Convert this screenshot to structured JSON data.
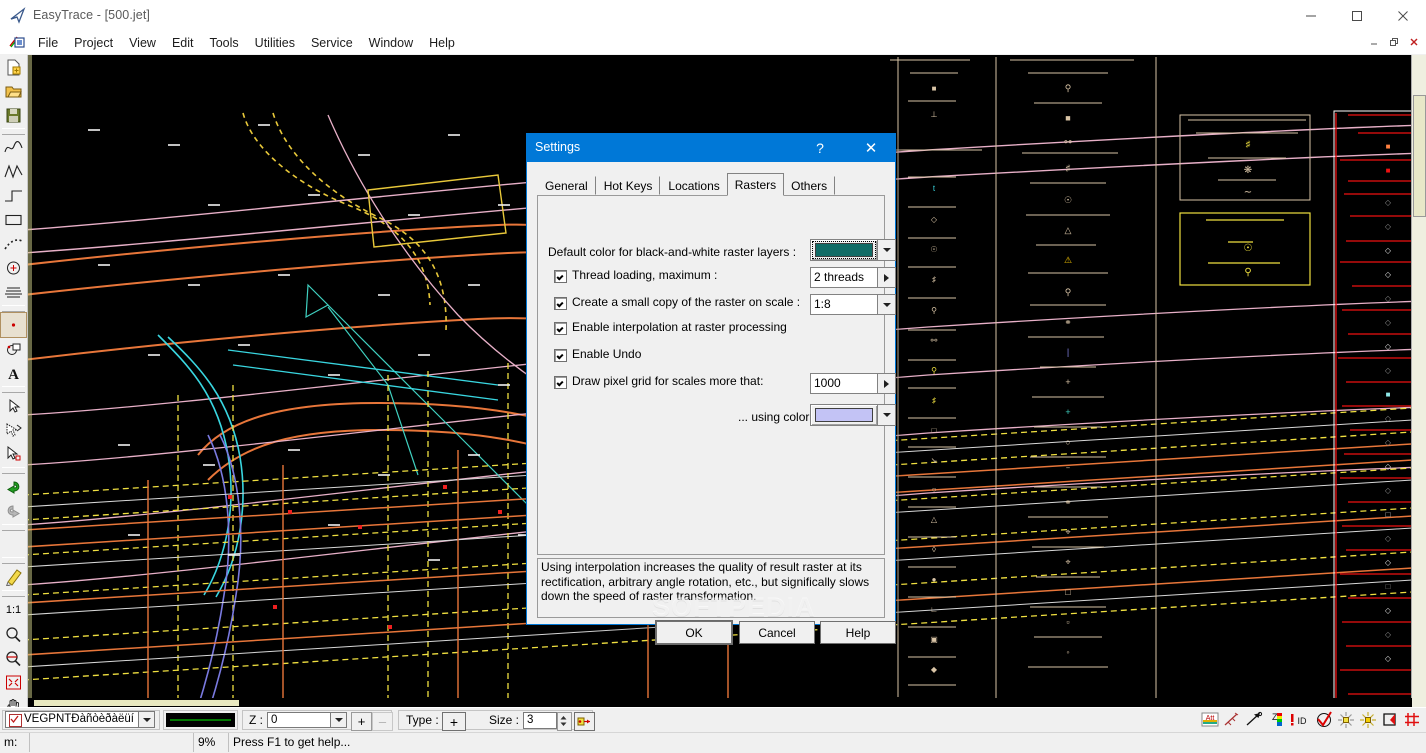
{
  "window": {
    "title": "EasyTrace - [500.jet]",
    "icon": "easytrace-logo-icon",
    "minimize": "–",
    "maximize": "□",
    "close": "✕"
  },
  "mdi": {
    "minimize": "–",
    "restore": "❐",
    "close": "✕"
  },
  "menu": {
    "items": [
      "File",
      "Project",
      "View",
      "Edit",
      "Tools",
      "Utilities",
      "Service",
      "Window",
      "Help"
    ]
  },
  "left_toolbar": {
    "groups": [
      {
        "items": [
          {
            "name": "new-document-icon",
            "glyph": "new"
          },
          {
            "name": "open-folder-icon",
            "glyph": "open"
          },
          {
            "name": "save-disk-icon",
            "glyph": "save"
          }
        ]
      },
      {
        "items": [
          {
            "name": "smooth-polyline-icon",
            "glyph": "curve"
          },
          {
            "name": "polyline-icon",
            "glyph": "zigzag"
          },
          {
            "name": "orthogonal-line-icon",
            "glyph": "step"
          },
          {
            "name": "rectangle-icon",
            "glyph": "rect"
          },
          {
            "name": "dashed-arc-icon",
            "glyph": "dots"
          },
          {
            "name": "circle-point-icon",
            "glyph": "circledot"
          },
          {
            "name": "hatch-fill-icon",
            "glyph": "hatch"
          }
        ]
      },
      {
        "items": [
          {
            "name": "point-object-icon",
            "glyph": "point",
            "selected": true
          },
          {
            "name": "symbol-object-icon",
            "glyph": "symbol"
          },
          {
            "name": "text-tool-icon",
            "glyph": "A"
          }
        ]
      },
      {
        "items": [
          {
            "name": "select-arrow-icon",
            "glyph": "arrow"
          },
          {
            "name": "select-lasso-icon",
            "glyph": "lasso"
          },
          {
            "name": "select-node-icon",
            "glyph": "arrownode"
          }
        ]
      },
      {
        "items": [
          {
            "name": "undo-icon",
            "glyph": "undo"
          },
          {
            "name": "redo-icon",
            "glyph": "redo"
          }
        ]
      },
      {
        "items": [
          {
            "name": "edit-pencil-icon",
            "glyph": "pencil"
          }
        ]
      },
      {
        "items": [
          {
            "name": "zoom-actual-size-button",
            "glyph": "1:1",
            "label": "1:1"
          },
          {
            "name": "zoom-in-icon",
            "glyph": "magnify"
          },
          {
            "name": "zoom-window-icon",
            "glyph": "magnifyred"
          },
          {
            "name": "zoom-extents-icon",
            "glyph": "extents"
          },
          {
            "name": "pan-hand-icon",
            "glyph": "hand"
          },
          {
            "name": "measure-ruler-icon",
            "glyph": "ruler"
          }
        ]
      }
    ]
  },
  "dialog": {
    "title": "Settings",
    "help_glyph": "?",
    "close_glyph": "✕",
    "tabs": [
      {
        "label": "General",
        "active": false
      },
      {
        "label": "Hot Keys",
        "active": false
      },
      {
        "label": "Locations",
        "active": false
      },
      {
        "label": "Rasters",
        "active": true
      },
      {
        "label": "Others",
        "active": false
      }
    ],
    "fields": {
      "default_color_label": "Default color for black-and-white raster layers :",
      "default_color_value": "#116c66",
      "thread_loading_label": "Thread loading, maximum :",
      "thread_loading_checked": true,
      "thread_loading_value": "2 threads",
      "small_copy_label": "Create a small copy of the raster on scale :",
      "small_copy_checked": true,
      "small_copy_value": "1:8",
      "interpolation_label": "Enable interpolation at raster processing",
      "interpolation_checked": true,
      "undo_label": "Enable Undo",
      "undo_checked": true,
      "pixel_grid_label": "Draw pixel grid for scales more that:",
      "pixel_grid_checked": true,
      "pixel_grid_value": "1000",
      "using_color_label": "... using color:",
      "using_color_value": "#c3c3f5"
    },
    "hint": "Using interpolation increases the quality of result raster at its rectification, arbitrary angle rotation, etc., but significally slows down the speed of raster transformation.",
    "buttons": {
      "ok": "OK",
      "cancel": "Cancel",
      "help": "Help"
    },
    "watermark": "SOFTPEDIA"
  },
  "bottom_toolbar": {
    "layer_checkbox_checked": true,
    "layer_name": "VEGPNTÐàñòèðàëüíû",
    "linestyle_preview_color": "#00c000",
    "z_label": "Z :",
    "z_value": "0",
    "z_plus": "+",
    "z_minus": "–",
    "type_label": "Type :",
    "type_value": "+",
    "size_label": "Size :",
    "size_value": "3",
    "snap_icon": "snap-to-point-icon",
    "right_icons": [
      {
        "name": "attributes-icon",
        "label": "Att"
      },
      {
        "name": "measure-angle-icon",
        "label": ""
      },
      {
        "name": "vector-direction-icon",
        "label": ""
      },
      {
        "name": "z-palette-icon",
        "label": "Z"
      },
      {
        "name": "object-id-icon",
        "label": "!ID"
      },
      {
        "name": "verify-topology-icon",
        "label": ""
      },
      {
        "name": "node-snap-grey-icon",
        "label": ""
      },
      {
        "name": "node-snap-yellow-icon",
        "label": ""
      },
      {
        "name": "polygon-fill-icon",
        "label": ""
      },
      {
        "name": "grid-icon",
        "label": ""
      }
    ]
  },
  "statusbar": {
    "units_label": "m:",
    "coordinate_value": "",
    "zoom_value": "9%",
    "hint": "Press F1 to get help..."
  },
  "canvas": {
    "background": "#000000",
    "description": "CAD vector map drawing of roads, utility networks and legend symbol panels"
  }
}
